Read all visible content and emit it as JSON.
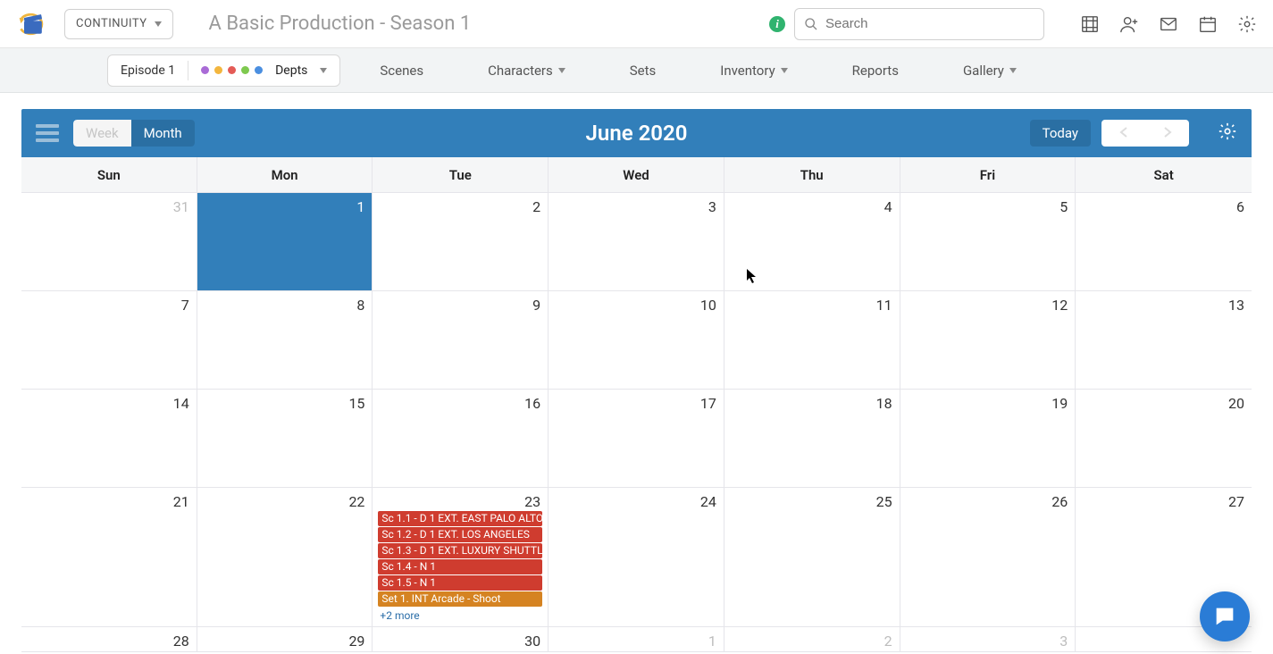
{
  "topbar": {
    "dept_select": "CONTINUITY",
    "title": "A Basic Production - Season 1",
    "search_placeholder": "Search"
  },
  "subnav": {
    "episode_label": "Episode 1",
    "dept_colors": [
      "#a96bd6",
      "#f3b63e",
      "#e45b56",
      "#7ec94f",
      "#4b8fe0"
    ],
    "depts_label": "Depts",
    "items": [
      "Scenes",
      "Characters",
      "Sets",
      "Inventory",
      "Reports",
      "Gallery"
    ],
    "has_caret": [
      false,
      true,
      false,
      true,
      false,
      true
    ]
  },
  "calendar": {
    "view_week": "Week",
    "view_month": "Month",
    "title": "June 2020",
    "today_label": "Today",
    "day_headers": [
      "Sun",
      "Mon",
      "Tue",
      "Wed",
      "Thu",
      "Fri",
      "Sat"
    ],
    "rows": [
      [
        {
          "n": "31",
          "other": true
        },
        {
          "n": "1",
          "today": true
        },
        {
          "n": "2"
        },
        {
          "n": "3"
        },
        {
          "n": "4"
        },
        {
          "n": "5"
        },
        {
          "n": "6"
        }
      ],
      [
        {
          "n": "7"
        },
        {
          "n": "8"
        },
        {
          "n": "9"
        },
        {
          "n": "10"
        },
        {
          "n": "11"
        },
        {
          "n": "12"
        },
        {
          "n": "13"
        }
      ],
      [
        {
          "n": "14"
        },
        {
          "n": "15"
        },
        {
          "n": "16"
        },
        {
          "n": "17"
        },
        {
          "n": "18"
        },
        {
          "n": "19"
        },
        {
          "n": "20"
        }
      ],
      [
        {
          "n": "21"
        },
        {
          "n": "22"
        },
        {
          "n": "23",
          "events": [
            {
              "t": "Sc 1.1 - D 1 EXT. EAST PALO ALTO",
              "c": "red"
            },
            {
              "t": "Sc 1.2 - D 1 EXT. LOS ANGELES",
              "c": "red"
            },
            {
              "t": "Sc 1.3 - D 1 EXT. LUXURY SHUTTL",
              "c": "red"
            },
            {
              "t": "Sc 1.4 - N 1",
              "c": "red"
            },
            {
              "t": "Sc 1.5 - N 1",
              "c": "red"
            },
            {
              "t": "Set 1. INT Arcade - Shoot",
              "c": "orange"
            }
          ],
          "more": "+2 more"
        },
        {
          "n": "24"
        },
        {
          "n": "25"
        },
        {
          "n": "26"
        },
        {
          "n": "27"
        }
      ],
      [
        {
          "n": "28"
        },
        {
          "n": "29"
        },
        {
          "n": "30"
        },
        {
          "n": "1",
          "other": true
        },
        {
          "n": "2",
          "other": true
        },
        {
          "n": "3",
          "other": true
        },
        {
          "n": ""
        }
      ]
    ]
  }
}
